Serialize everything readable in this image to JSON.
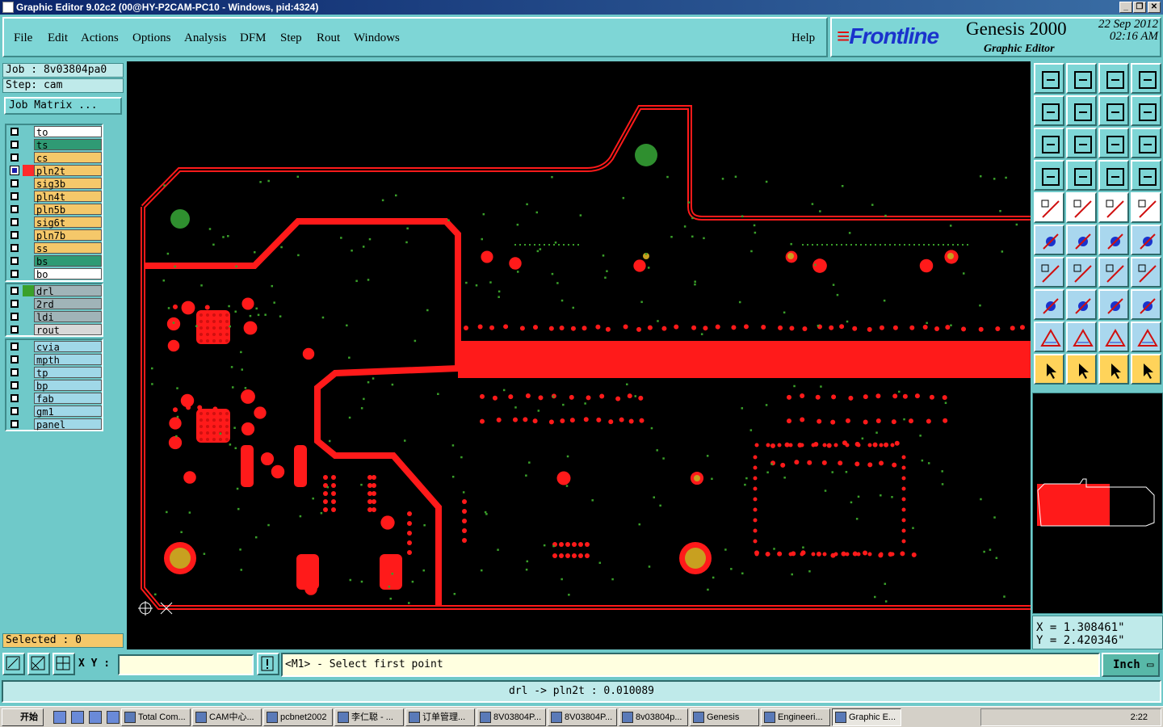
{
  "window": {
    "title": "Graphic Editor 9.02c2 (00@HY-P2CAM-PC10 - Windows, pid:4324)"
  },
  "menu": {
    "items": [
      "File",
      "Edit",
      "Actions",
      "Options",
      "Analysis",
      "DFM",
      "Step",
      "Rout",
      "Windows"
    ],
    "help": "Help"
  },
  "brand": {
    "logo": "Frontline",
    "product": "Genesis 2000",
    "subtitle": "Graphic Editor",
    "date": "22 Sep 2012",
    "time": "02:16 AM"
  },
  "job": {
    "job_line": "Job : 8v03804pa0",
    "step_line": "Step: cam",
    "matrix_button": "Job Matrix ..."
  },
  "layers": {
    "group1": [
      {
        "name": "to",
        "color": "#ffffff",
        "selected": false
      },
      {
        "name": "ts",
        "color": "#2f9a74",
        "selected": false
      },
      {
        "name": "cs",
        "color": "#f5c86a",
        "selected": false
      },
      {
        "name": "pln2t",
        "color": "#f5c86a",
        "selected": true,
        "swatch": "#ff2a2a"
      },
      {
        "name": "sig3b",
        "color": "#f5c86a",
        "selected": false
      },
      {
        "name": "pln4t",
        "color": "#f5c86a",
        "selected": false
      },
      {
        "name": "pln5b",
        "color": "#f5c86a",
        "selected": false
      },
      {
        "name": "sig6t",
        "color": "#f5c86a",
        "selected": false
      },
      {
        "name": "pln7b",
        "color": "#f5c86a",
        "selected": false
      },
      {
        "name": "ss",
        "color": "#f5c86a",
        "selected": false
      },
      {
        "name": "bs",
        "color": "#2f9a74",
        "selected": false
      },
      {
        "name": "bo",
        "color": "#ffffff",
        "selected": false
      }
    ],
    "group2": [
      {
        "name": "drl",
        "color": "#a0b4b8",
        "selected": false,
        "swatch": "#3aa02a"
      },
      {
        "name": "2rd",
        "color": "#a0b4b8",
        "selected": false
      },
      {
        "name": "ldi",
        "color": "#a0b4b8",
        "selected": false
      },
      {
        "name": "rout",
        "color": "#d8d8d8",
        "selected": false
      }
    ],
    "group3": [
      {
        "name": "cvia",
        "color": "#a0d8e8",
        "selected": false
      },
      {
        "name": "mpth",
        "color": "#a0d8e8",
        "selected": false
      },
      {
        "name": "tp",
        "color": "#a0d8e8",
        "selected": false
      },
      {
        "name": "bp",
        "color": "#a0d8e8",
        "selected": false
      },
      {
        "name": "fab",
        "color": "#a0d8e8",
        "selected": false
      },
      {
        "name": "gm1",
        "color": "#a0d8e8",
        "selected": false
      },
      {
        "name": "panel",
        "color": "#a0d8e8",
        "selected": false
      }
    ]
  },
  "selected": "Selected : 0",
  "coords": {
    "x": "X = 1.308461\"",
    "y": "Y = 2.420346\""
  },
  "cmd": {
    "xy_label": "X Y :",
    "xy_value": "",
    "prompt": "<M1> - Select first point",
    "unit": "Inch"
  },
  "status": "drl -> pln2t : 0.010089",
  "taskbar": {
    "start": "开始",
    "tasks": [
      "Total Com...",
      "CAM中心...",
      "pcbnet2002",
      "李仁聪 - ...",
      "订单管理...",
      "8V03804P...",
      "8V03804P...",
      "8v03804p...",
      "Genesis",
      "Engineeri...",
      "Graphic E..."
    ],
    "clock": "2:22"
  },
  "colors": {
    "copper": "#ff1a1a",
    "drill": "#2f8f2f",
    "pad_center": "#c8a020",
    "bg": "#000000",
    "accent": "#6fc9c9"
  }
}
